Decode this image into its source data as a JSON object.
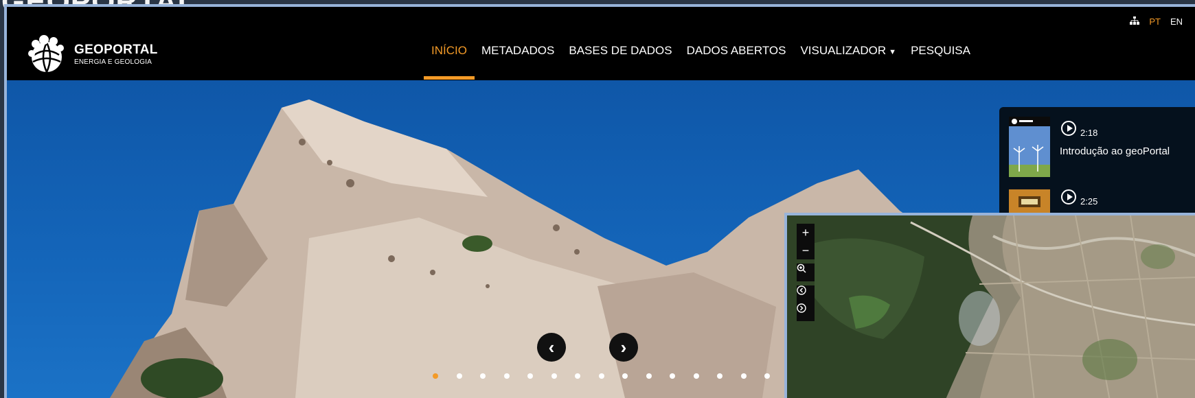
{
  "background_text": "GEOPORTAL",
  "brand": {
    "title": "GEOPORTAL",
    "subtitle": "ENERGIA E GEOLOGIA"
  },
  "nav": [
    {
      "label": "INÍCIO",
      "active": true
    },
    {
      "label": "METADADOS"
    },
    {
      "label": "BASES DE DADOS"
    },
    {
      "label": "DADOS ABERTOS"
    },
    {
      "label": "VISUALIZADOR",
      "dropdown": true
    },
    {
      "label": "PESQUISA"
    }
  ],
  "lang": {
    "sitemap_icon": "sitemap-icon",
    "pt": "PT",
    "en": "EN"
  },
  "carousel": {
    "prev_icon": "chevron-left-icon",
    "next_icon": "chevron-right-icon",
    "slide_count": 15,
    "active_index": 0
  },
  "videos": [
    {
      "duration": "2:18",
      "title": "Introdução ao geoPortal"
    },
    {
      "duration": "2:25",
      "title": ""
    }
  ],
  "map_controls": [
    "zoom-in-icon",
    "zoom-out-icon",
    "zoom-box-icon",
    "previous-extent-icon",
    "next-extent-icon"
  ],
  "colors": {
    "accent": "#f39a27",
    "frame": "#98b4da",
    "header_bg": "#000000"
  }
}
